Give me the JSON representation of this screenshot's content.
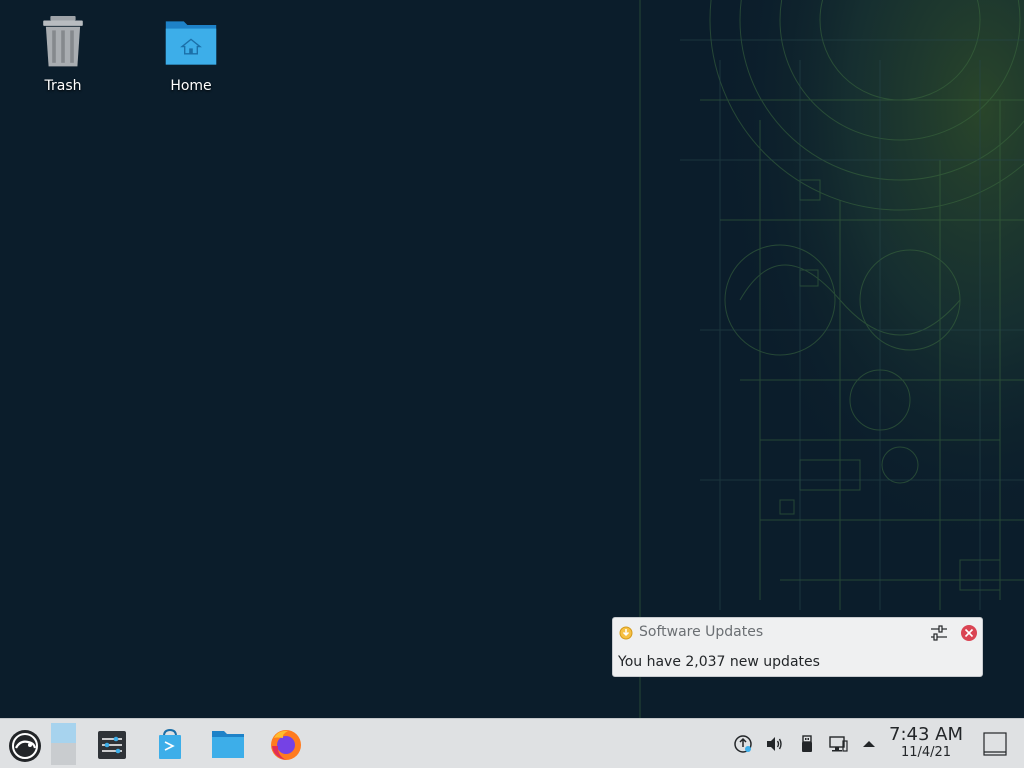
{
  "desktop": {
    "icons": [
      {
        "label": "Trash",
        "icon": "trash-icon"
      },
      {
        "label": "Home",
        "icon": "home-folder-icon"
      }
    ]
  },
  "notification": {
    "app_icon": "software-updates-icon",
    "title": "Software Updates",
    "body": "You have 2,037 new updates",
    "config_icon": "configure-icon",
    "close_icon": "close-icon"
  },
  "panel": {
    "launcher_icon": "opensuse-launcher-icon",
    "pager_icon": "virtual-desktop-pager-icon",
    "tasks": [
      {
        "icon": "system-settings-icon"
      },
      {
        "icon": "discover-store-icon"
      },
      {
        "icon": "dolphin-file-manager-icon"
      },
      {
        "icon": "firefox-icon"
      }
    ],
    "tray": [
      {
        "icon": "updates-icon"
      },
      {
        "icon": "volume-icon"
      },
      {
        "icon": "usb-device-icon"
      },
      {
        "icon": "network-icon"
      },
      {
        "icon": "expand-tray-icon"
      }
    ],
    "clock": {
      "time": "7:43 AM",
      "date": "11/4/21"
    },
    "show_desktop_icon": "show-desktop-icon"
  },
  "colors": {
    "desktop_bg": "#0b1d2b",
    "panel_bg": "#dfe1e3",
    "notification_bg": "#eff0f1",
    "accent_blue": "#3daee9",
    "close_red": "#da4453"
  }
}
